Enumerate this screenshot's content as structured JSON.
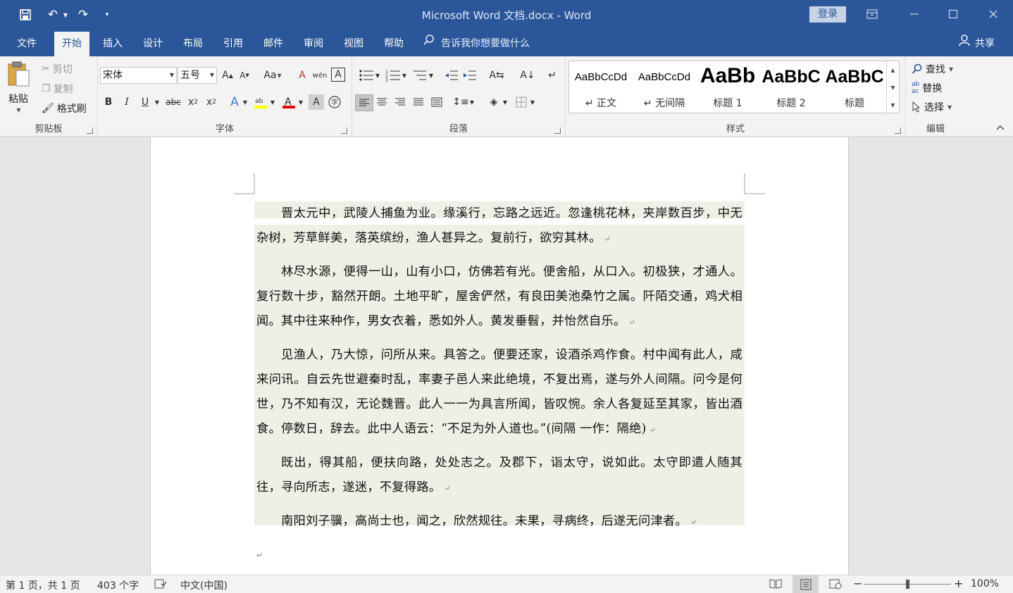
{
  "window": {
    "title": "Microsoft Word 文档.docx  -  Word",
    "login_label": "登录"
  },
  "tabs": [
    "文件",
    "开始",
    "插入",
    "设计",
    "布局",
    "引用",
    "邮件",
    "审阅",
    "视图",
    "帮助"
  ],
  "active_tab": "开始",
  "tell_me": "告诉我你想要做什么",
  "share_label": "共享",
  "clipboard": {
    "paste": "粘贴",
    "cut": "剪切",
    "copy": "复制",
    "format_painter": "格式刷",
    "label": "剪贴板"
  },
  "font": {
    "family": "宋体",
    "size": "五号",
    "label": "字体",
    "change_case": "Aa"
  },
  "paragraph": {
    "label": "段落"
  },
  "styles": {
    "label": "样式",
    "items": [
      {
        "sample": "AaBbCcDd",
        "name": "↵ 正文"
      },
      {
        "sample": "AaBbCcDd",
        "name": "↵ 无间隔"
      },
      {
        "sample": "AaBb",
        "name": "标题 1"
      },
      {
        "sample": "AaBbC",
        "name": "标题 2"
      },
      {
        "sample": "AaBbC",
        "name": "标题"
      }
    ]
  },
  "editing": {
    "find": "查找",
    "replace": "替换",
    "select": "选择",
    "label": "编辑"
  },
  "document": {
    "paragraphs": [
      "晋太元中，武陵人捕鱼为业。缘溪行，忘路之远近。忽逢桃花林，夹岸数百步，中无杂树，芳草鲜美，落英缤纷，渔人甚异之。复前行，欲穷其林。",
      "林尽水源，便得一山，山有小口，仿佛若有光。便舍船，从口入。初极狭，才通人。复行数十步，豁然开朗。土地平旷，屋舍俨然，有良田美池桑竹之属。阡陌交通，鸡犬相闻。其中往来种作，男女衣着，悉如外人。黄发垂髫，并怡然自乐。",
      "见渔人，乃大惊，问所从来。具答之。便要还家，设酒杀鸡作食。村中闻有此人，咸来问讯。自云先世避秦时乱，率妻子邑人来此绝境，不复出焉，遂与外人间隔。问今是何世，乃不知有汉，无论魏晋。此人一一为具言所闻，皆叹惋。余人各复延至其家，皆出酒食。停数日，辞去。此中人语云：“不足为外人道也。”(间隔 一作：隔绝)",
      "既出，得其船，便扶向路，处处志之。及郡下，诣太守，说如此。太守即遣人随其往，寻向所志，遂迷，不复得路。",
      "南阳刘子骥，高尚士也，闻之，欣然规往。未果，寻病终，后遂无问津者。"
    ],
    "para_mark": "↵"
  },
  "status": {
    "page": "第 1 页，共 1 页",
    "words": "403 个字",
    "language": "中文(中国)",
    "zoom": "100%"
  },
  "colors": {
    "accent": "#2b579a",
    "ribbon_bg": "#f3f3f3",
    "highlight_shading": "#f0efe6"
  }
}
